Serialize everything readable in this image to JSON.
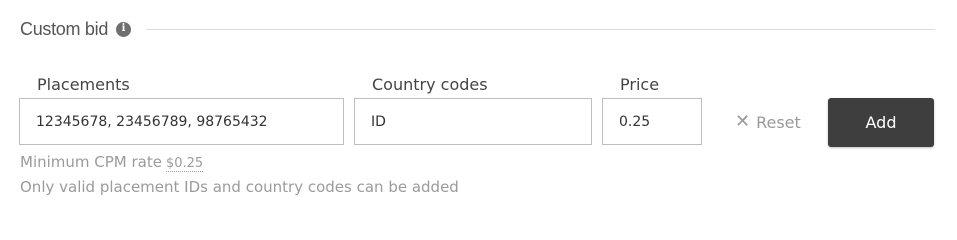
{
  "section": {
    "title": "Custom bid",
    "info_icon": "info-icon"
  },
  "fields": {
    "placements": {
      "label": "Placements",
      "value": "12345678, 23456789, 98765432"
    },
    "country_codes": {
      "label": "Country codes",
      "value": "ID"
    },
    "price": {
      "label": "Price",
      "value": "0.25"
    }
  },
  "actions": {
    "reset_label": "Reset",
    "reset_icon": "close-icon",
    "add_label": "Add"
  },
  "hints": {
    "min_cpm_label": "Minimum CPM rate",
    "min_cpm_value": "$0.25",
    "validity_note": "Only valid placement IDs and country codes can be added"
  },
  "colors": {
    "button_dark": "#3e3e3e",
    "muted_text": "#9b9b9b",
    "border": "#bdbdbd"
  }
}
